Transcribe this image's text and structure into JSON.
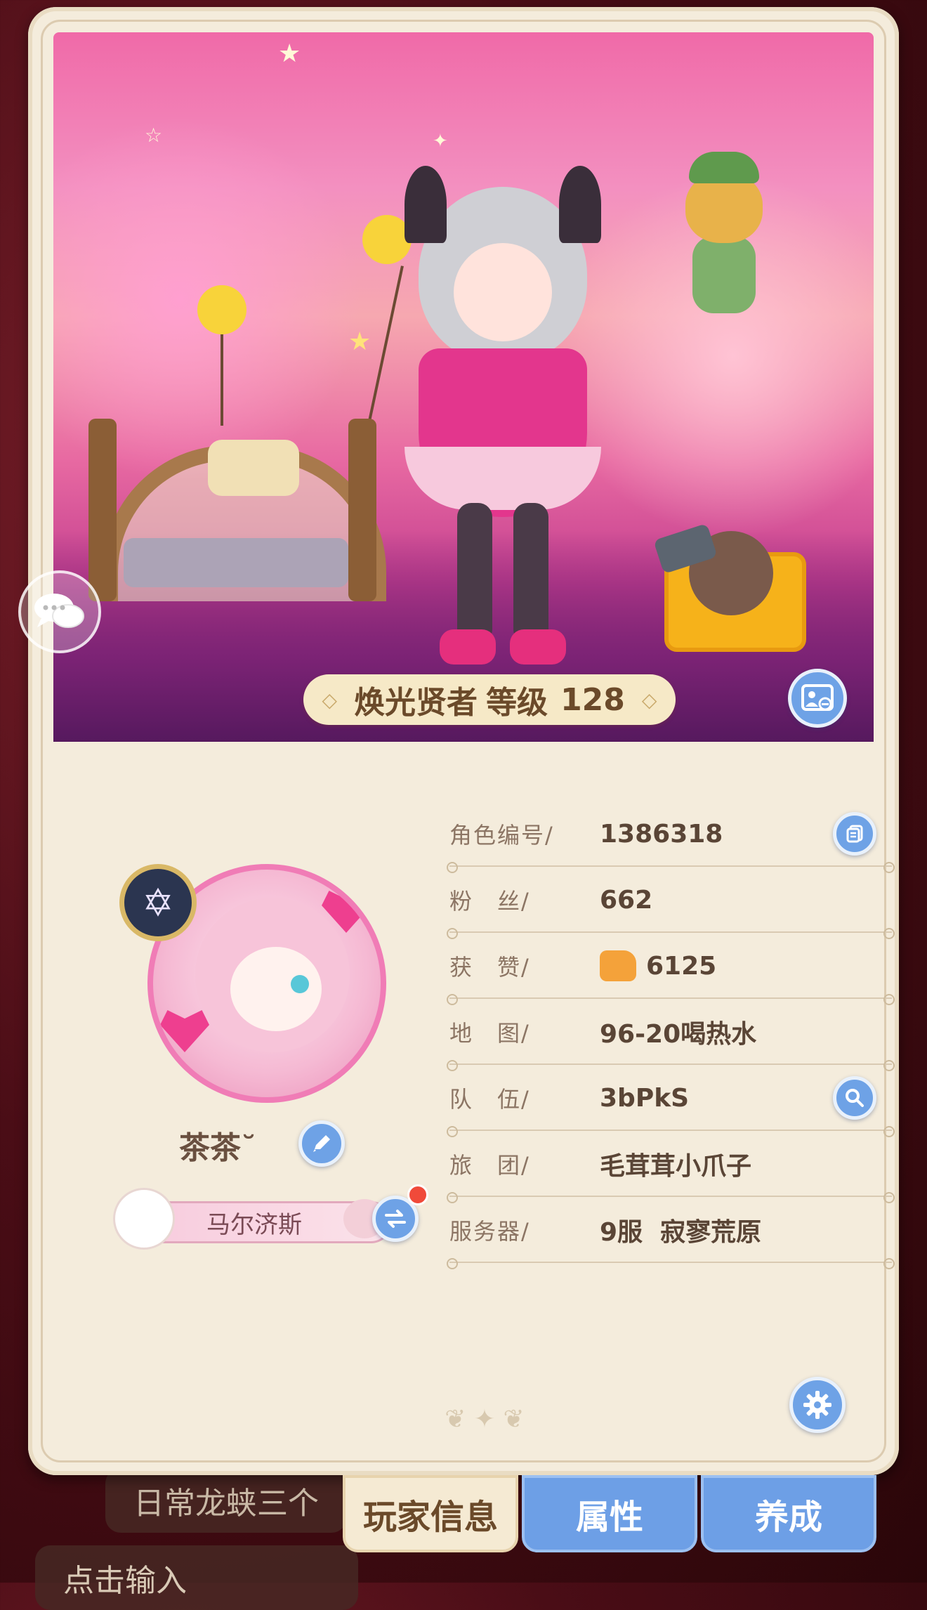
{
  "background": {
    "hint_left_pill": "日常龙蛱三个",
    "hint_input": "点击输入"
  },
  "banner": {
    "title": "焕光贤者",
    "level_label": "等级",
    "level_value": "128"
  },
  "profile": {
    "name": "茶茶˘",
    "title_tag": "马尔济斯"
  },
  "info": [
    {
      "label": "角色编号/",
      "value": "1386318",
      "action": "copy"
    },
    {
      "label": "粉　丝/",
      "value": "662"
    },
    {
      "label": "获　赞/",
      "value": "6125",
      "icon": "thumbs-up-icon"
    },
    {
      "label": "地　图/",
      "value": "96-20喝热水"
    },
    {
      "label": "队　伍/",
      "value": "3bPkS",
      "action": "search"
    },
    {
      "label": "旅　团/",
      "value": "毛茸茸小爪子"
    },
    {
      "label": "服务器/",
      "value": "9服  寂寥荒原"
    }
  ],
  "tabs": [
    {
      "label": "玩家信息",
      "active": true
    },
    {
      "label": "属性",
      "active": false
    },
    {
      "label": "养成",
      "active": false
    }
  ],
  "colors": {
    "accent_blue": "#6ea2e6",
    "card_bg": "#f4ecdc",
    "text_brown": "#5a4536",
    "badge_red": "#f04a3a"
  }
}
